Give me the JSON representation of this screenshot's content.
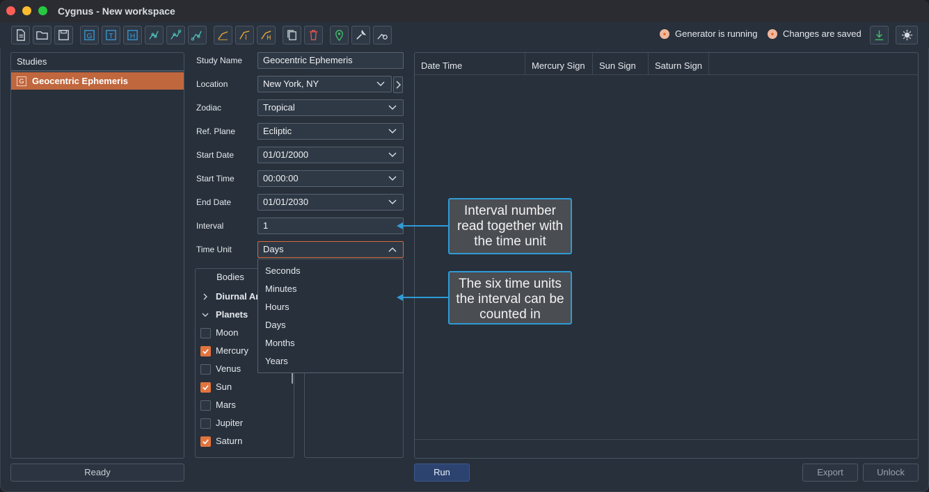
{
  "window": {
    "title": "Cygnus - New workspace"
  },
  "toolbar": {
    "buttons": [
      {
        "name": "new-file",
        "icon": "file-icon"
      },
      {
        "name": "open-folder",
        "icon": "folder-icon"
      },
      {
        "name": "save",
        "icon": "save-icon"
      },
      {
        "name": "study-g",
        "icon": "g-square-icon",
        "glyph": "G"
      },
      {
        "name": "study-t",
        "icon": "t-square-icon",
        "glyph": "T"
      },
      {
        "name": "study-h",
        "icon": "h-square-icon",
        "glyph": "H"
      },
      {
        "name": "graph-g",
        "icon": "graph-g-icon"
      },
      {
        "name": "graph-t",
        "icon": "graph-t-icon"
      },
      {
        "name": "graph-h",
        "icon": "graph-h-icon"
      },
      {
        "name": "chart-g",
        "icon": "chart-g-icon"
      },
      {
        "name": "chart-t",
        "icon": "chart-t-icon"
      },
      {
        "name": "chart-h",
        "icon": "chart-h-icon"
      },
      {
        "name": "copy",
        "icon": "copy-icon"
      },
      {
        "name": "delete",
        "icon": "trash-icon"
      },
      {
        "name": "location",
        "icon": "map-pin-icon"
      },
      {
        "name": "tools",
        "icon": "wrench-icon"
      },
      {
        "name": "settings",
        "icon": "settings-icon"
      }
    ],
    "status": {
      "generator": "Generator is running",
      "saved": "Changes are saved"
    },
    "download_icon": "download-icon",
    "theme_icon": "sun-icon"
  },
  "studies": {
    "header": "Studies",
    "items": [
      {
        "label": "Geocentric Ephemeris",
        "glyph": "G"
      }
    ],
    "status_button": "Ready"
  },
  "form": {
    "study_name": {
      "label": "Study Name",
      "value": "Geocentric Ephemeris"
    },
    "location": {
      "label": "Location",
      "value": "New York, NY"
    },
    "zodiac": {
      "label": "Zodiac",
      "value": "Tropical"
    },
    "ref_plane": {
      "label": "Ref. Plane",
      "value": "Ecliptic"
    },
    "start_date": {
      "label": "Start Date",
      "value": "01/01/2000"
    },
    "start_time": {
      "label": "Start Time",
      "value": "00:00:00"
    },
    "end_date": {
      "label": "End Date",
      "value": "01/01/2030"
    },
    "interval": {
      "label": "Interval",
      "value": "1"
    },
    "time_unit": {
      "label": "Time Unit",
      "value": "Days",
      "options": [
        "Seconds",
        "Minutes",
        "Hours",
        "Days",
        "Months",
        "Years"
      ]
    }
  },
  "bodies": {
    "tab": "Bodies",
    "groups": [
      {
        "label": "Diurnal An",
        "expanded": false
      },
      {
        "label": "Planets",
        "expanded": true
      }
    ],
    "items": [
      {
        "label": "Moon",
        "checked": false
      },
      {
        "label": "Mercury",
        "checked": true
      },
      {
        "label": "Venus",
        "checked": false
      },
      {
        "label": "Sun",
        "checked": true
      },
      {
        "label": "Mars",
        "checked": false
      },
      {
        "label": "Jupiter",
        "checked": false
      },
      {
        "label": "Saturn",
        "checked": true
      }
    ]
  },
  "results": {
    "columns": [
      "Date Time",
      "Mercury Sign",
      "Sun Sign",
      "Saturn Sign"
    ]
  },
  "actions": {
    "run": "Run",
    "export": "Export",
    "unlock": "Unlock"
  },
  "callouts": {
    "interval": "Interval number read together with the time unit",
    "units": "The six time units the interval can be counted in"
  },
  "colors": {
    "accent": "#e2743e",
    "selection": "#c0673e",
    "callout_border": "#2f9bd6",
    "run_button": "#2c4370"
  }
}
